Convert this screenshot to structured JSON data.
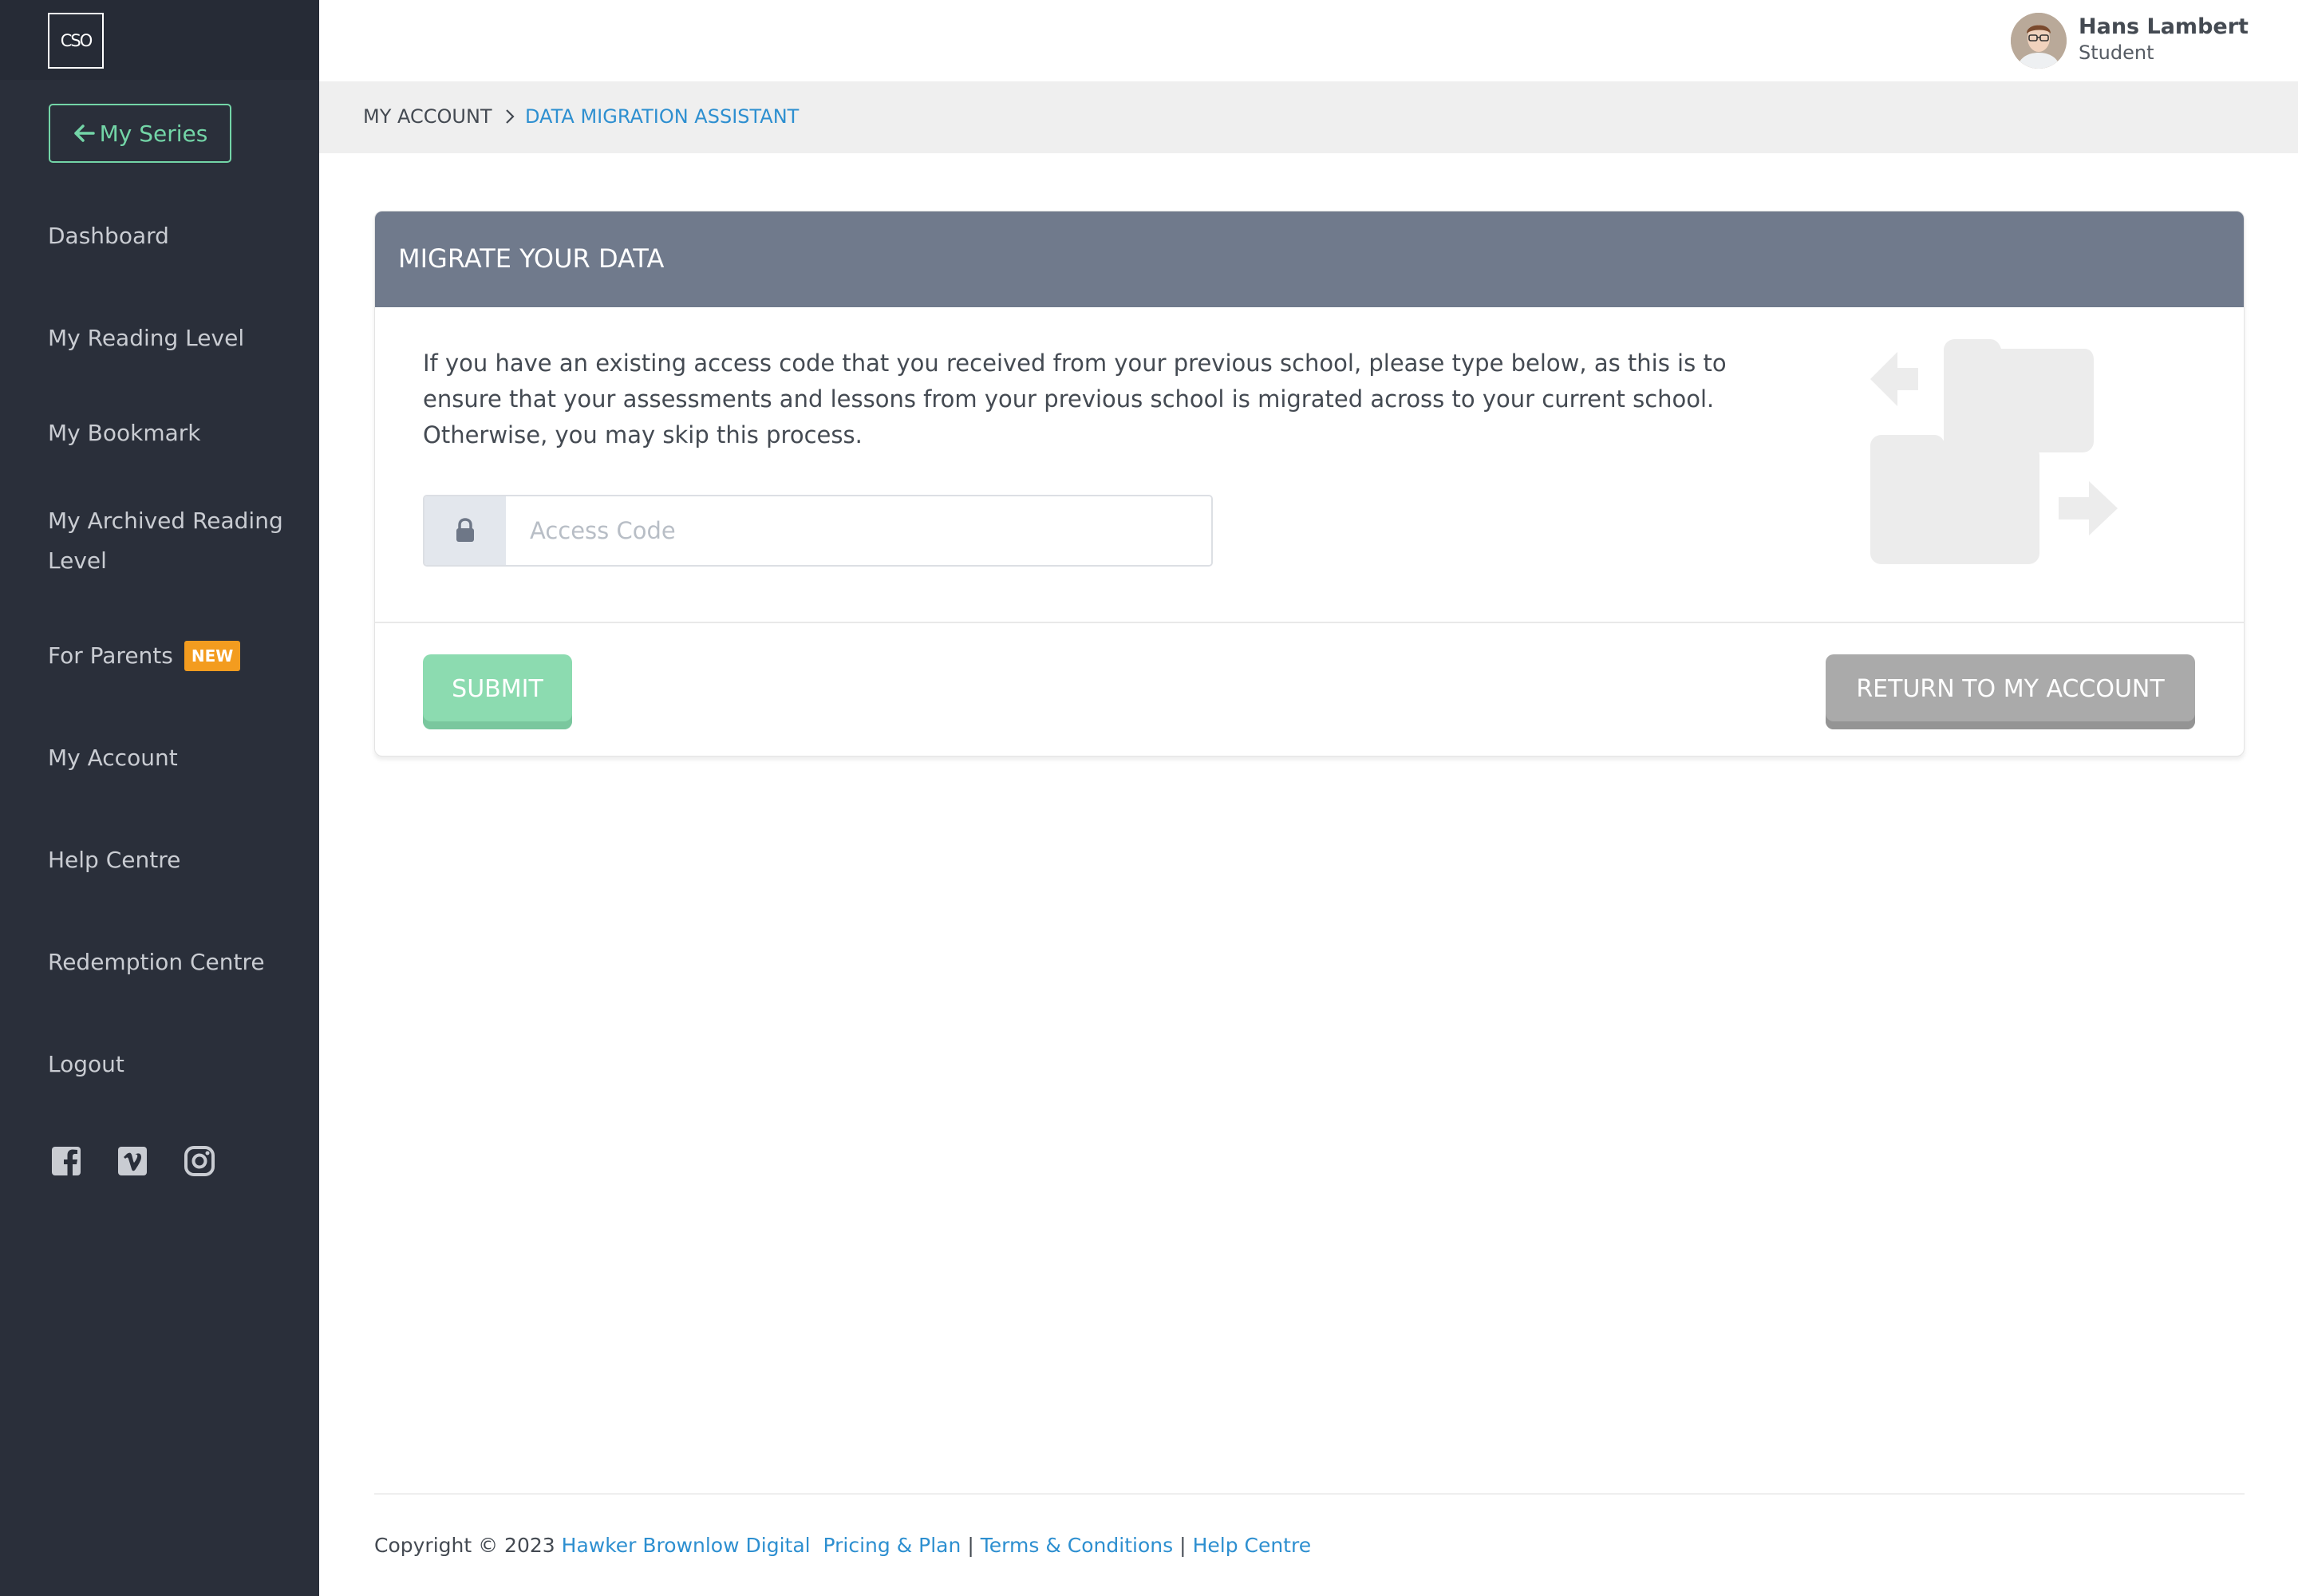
{
  "sidebar": {
    "logo_text": "CSO",
    "back_button_label": "My Series",
    "items": [
      {
        "label": "Dashboard"
      },
      {
        "label": "My Reading Level"
      },
      {
        "label": "My Bookmark"
      },
      {
        "label": "My Archived Reading Level"
      },
      {
        "label": "For Parents",
        "badge": "NEW"
      },
      {
        "label": "My Account"
      },
      {
        "label": "Help Centre"
      },
      {
        "label": "Redemption Centre"
      },
      {
        "label": "Logout"
      }
    ],
    "social_icons": [
      "facebook-icon",
      "vimeo-icon",
      "instagram-icon"
    ],
    "colors": {
      "background": "#2a2f3a",
      "accent": "#73d5a7",
      "badge": "#f39c1f"
    }
  },
  "header": {
    "user_name": "Hans Lambert",
    "user_role": "Student"
  },
  "breadcrumb": {
    "root": "MY ACCOUNT",
    "current": "DATA MIGRATION ASSISTANT"
  },
  "card": {
    "title": "MIGRATE YOUR DATA",
    "description": "If you have an existing access code that you received from your previous school, please type below, as this is to ensure that your assessments and lessons from your previous school is migrated across to your current school. Otherwise, you may skip this process.",
    "input": {
      "placeholder": "Access Code",
      "value": ""
    },
    "submit_label": "SUBMIT",
    "return_label": "RETURN TO MY ACCOUNT",
    "colors": {
      "header": "#707a8c",
      "submit": "#8cdbb0",
      "return": "#aaaaaa"
    }
  },
  "footer": {
    "copyright": "Copyright © 2023",
    "company": "Hawker Brownlow Digital",
    "links": [
      "Pricing & Plan",
      "Terms & Conditions",
      "Help Centre"
    ],
    "link_color": "#2d8fd0"
  }
}
